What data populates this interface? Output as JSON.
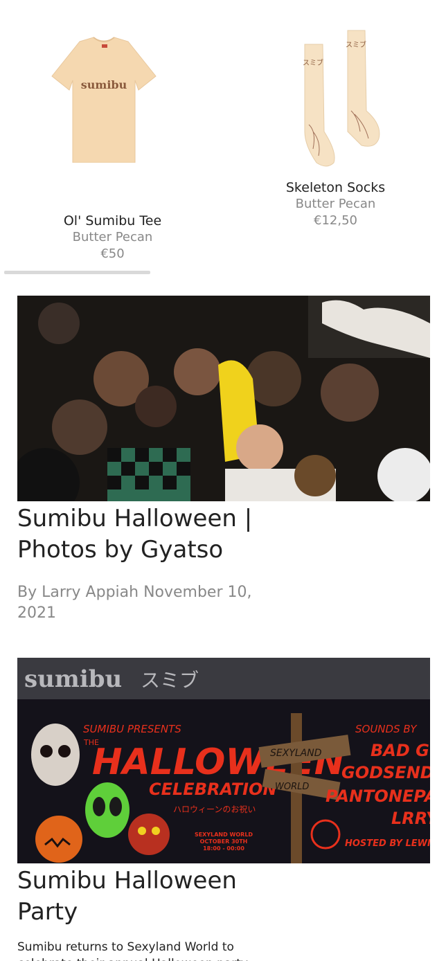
{
  "products": [
    {
      "name": "Ol' Sumibu Tee",
      "variant": "Butter Pecan",
      "price": "€50",
      "print": "sumibu"
    },
    {
      "name": "Skeleton Socks",
      "variant": "Butter Pecan",
      "price": "€12,50",
      "print": "スミブ"
    }
  ],
  "articles": [
    {
      "title": "Sumibu Halloween | Photos by Gyatso",
      "byline": "By Larry Appiah November 10, 2021"
    },
    {
      "title": "Sumibu Halloween Party",
      "excerpt": "Sumibu returns to Sexyland World to celebrate their annual Halloween party",
      "poster": {
        "brand": "sumibu",
        "brand_jp": "スミブ",
        "presents": "SUMIBU PRESENTS",
        "the": "THE",
        "headline": "HALLOWEEN",
        "subheadline": "CELEBRATION",
        "subheadline_jp": "ハロウィーンのお祝い",
        "sign_top": "SEXYLAND",
        "sign_bottom": "WORLD",
        "venue": "SEXYLAND WORLD",
        "date": "OCTOBER 30TH",
        "time": "18:00 - 00:00",
        "sounds_by": "SOUNDS BY",
        "artists": [
          "BAD G",
          "GODSENDO",
          "PANTONEPAPI",
          "LRRY"
        ],
        "hosted_by": "HOSTED BY LEWIS"
      }
    }
  ]
}
